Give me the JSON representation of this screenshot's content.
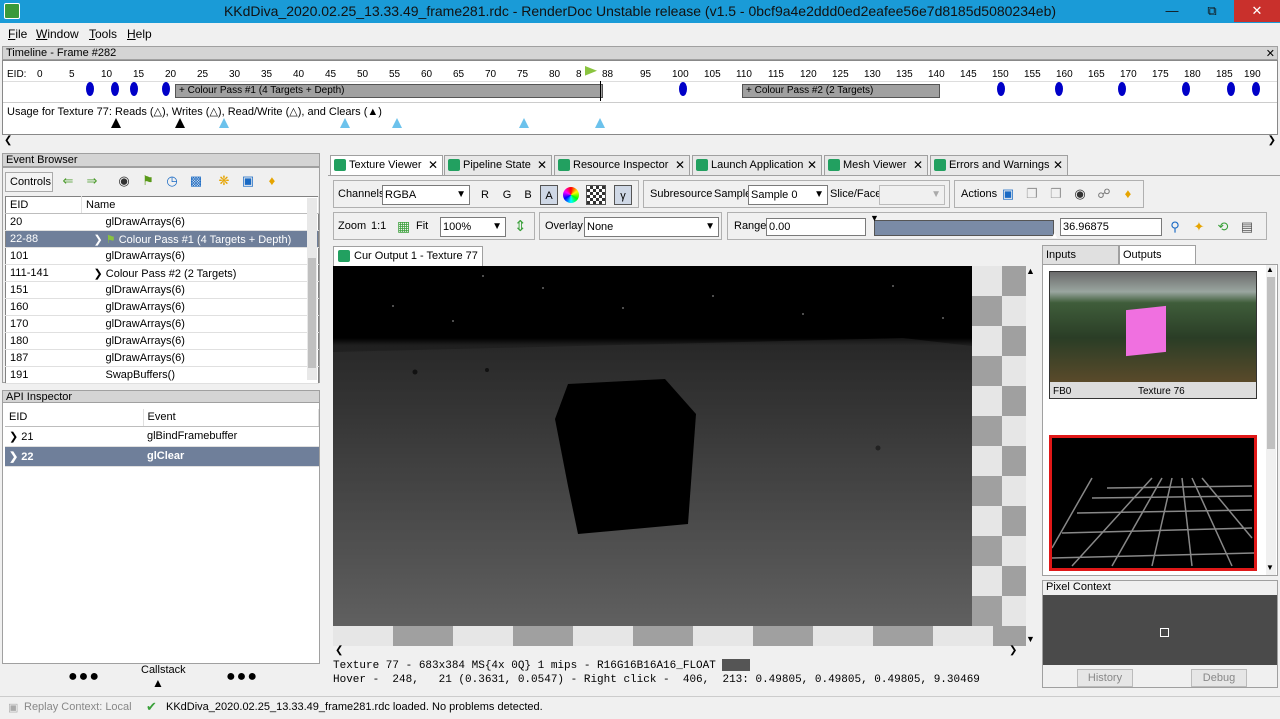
{
  "window": {
    "title": "KKdDiva_2020.02.25_13.33.49_frame281.rdc - RenderDoc Unstable release (v1.5 - 0bcf9a4e2ddd0ed2eafee56e7d8185d5080234eb)"
  },
  "menu": [
    "File",
    "Window",
    "Tools",
    "Help"
  ],
  "timeline": {
    "title": "Timeline - Frame #282",
    "eid_label": "EID:",
    "ticks": [
      "0",
      "5",
      "10",
      "15",
      "20",
      "25",
      "30",
      "35",
      "40",
      "45",
      "50",
      "55",
      "60",
      "65",
      "70",
      "75",
      "80",
      "8",
      "88",
      "95",
      "100",
      "105",
      "110",
      "115",
      "120",
      "125",
      "130",
      "135",
      "140",
      "145",
      "150",
      "155",
      "160",
      "165",
      "170",
      "175",
      "180",
      "185",
      "190"
    ],
    "pass1": "+ Colour Pass #1 (4 Targets + Depth)",
    "pass2": "+ Colour Pass #2 (2 Targets)",
    "usage_text": "Usage for Texture 77: Reads (△), Writes (△), Read/Write (△), and Clears (▲)"
  },
  "event_browser": {
    "title": "Event Browser",
    "controls_label": "Controls",
    "col_eid": "EID",
    "col_name": "Name",
    "rows": [
      {
        "eid": "20",
        "name": "glDrawArrays(6)"
      },
      {
        "eid": "22-88",
        "name": "Colour Pass #1 (4 Targets + Depth)"
      },
      {
        "eid": "101",
        "name": "glDrawArrays(6)"
      },
      {
        "eid": "111-141",
        "name": "Colour Pass #2 (2 Targets)"
      },
      {
        "eid": "151",
        "name": "glDrawArrays(6)"
      },
      {
        "eid": "160",
        "name": "glDrawArrays(6)"
      },
      {
        "eid": "170",
        "name": "glDrawArrays(6)"
      },
      {
        "eid": "180",
        "name": "glDrawArrays(6)"
      },
      {
        "eid": "187",
        "name": "glDrawArrays(6)"
      },
      {
        "eid": "191",
        "name": "SwapBuffers()"
      }
    ]
  },
  "api_inspector": {
    "title": "API Inspector",
    "col_eid": "EID",
    "col_event": "Event",
    "rows": [
      {
        "eid": "21",
        "event": "glBindFramebuffer"
      },
      {
        "eid": "22",
        "event": "glClear"
      }
    ],
    "callstack": "Callstack"
  },
  "tabs": [
    "Texture Viewer",
    "Pipeline State",
    "Resource Inspector",
    "Launch Application",
    "Mesh Viewer",
    "Errors and Warnings"
  ],
  "toolbar": {
    "channels_label": "Channels",
    "channels_value": "RGBA",
    "r": "R",
    "g": "G",
    "b": "B",
    "a": "A",
    "gamma": "γ",
    "subresource": "Subresource",
    "sample_label": "Sample",
    "sample_value": "Sample 0",
    "slice_label": "Slice/Face",
    "actions_label": "Actions",
    "zoom_label": "Zoom",
    "zoom_11": "1:1",
    "fit": "Fit",
    "zoom_value": "100%",
    "overlay_label": "Overlay",
    "overlay_value": "None",
    "range_label": "Range",
    "range_min": "0.00",
    "range_max": "36.96875"
  },
  "output_tab": "Cur Output 1 - Texture 77",
  "texture_info": "Texture 77 - 683x384 MS{4x 0Q} 1 mips - R16G16B16A16_FLOAT",
  "hover_info": "Hover -  248,   21 (0.3631, 0.0547) - Right click -  406,  213: 0.49805, 0.49805, 0.49805, 9.30469",
  "side_tabs": {
    "inputs": "Inputs",
    "outputs": "Outputs"
  },
  "thumb1": {
    "left": "FB0",
    "right": "Texture 76"
  },
  "pixel_context": {
    "title": "Pixel Context",
    "history": "History",
    "debug": "Debug"
  },
  "status": {
    "replay": "Replay Context: Local",
    "message": "KKdDiva_2020.02.25_13.33.49_frame281.rdc loaded. No problems detected."
  },
  "colors": {
    "titlebar": "#1a9bd7",
    "selection": "#6f7f9a",
    "eid_marker": "#0000c8",
    "close": "#c9302c"
  }
}
